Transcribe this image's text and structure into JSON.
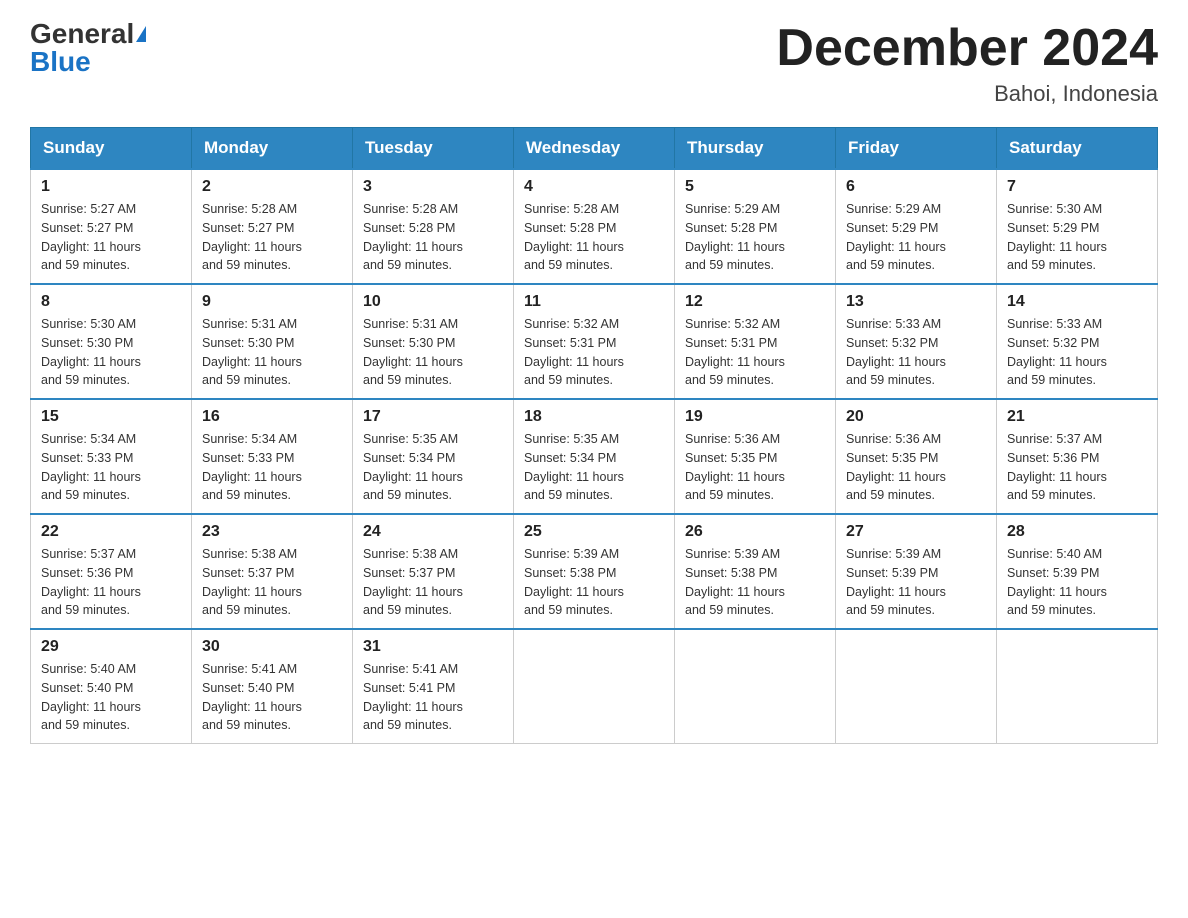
{
  "header": {
    "logo_general": "General",
    "logo_blue": "Blue",
    "month_title": "December 2024",
    "location": "Bahoi, Indonesia"
  },
  "weekdays": [
    "Sunday",
    "Monday",
    "Tuesday",
    "Wednesday",
    "Thursday",
    "Friday",
    "Saturday"
  ],
  "weeks": [
    [
      {
        "day": "1",
        "sunrise": "5:27 AM",
        "sunset": "5:27 PM",
        "daylight": "11 hours and 59 minutes."
      },
      {
        "day": "2",
        "sunrise": "5:28 AM",
        "sunset": "5:27 PM",
        "daylight": "11 hours and 59 minutes."
      },
      {
        "day": "3",
        "sunrise": "5:28 AM",
        "sunset": "5:28 PM",
        "daylight": "11 hours and 59 minutes."
      },
      {
        "day": "4",
        "sunrise": "5:28 AM",
        "sunset": "5:28 PM",
        "daylight": "11 hours and 59 minutes."
      },
      {
        "day": "5",
        "sunrise": "5:29 AM",
        "sunset": "5:28 PM",
        "daylight": "11 hours and 59 minutes."
      },
      {
        "day": "6",
        "sunrise": "5:29 AM",
        "sunset": "5:29 PM",
        "daylight": "11 hours and 59 minutes."
      },
      {
        "day": "7",
        "sunrise": "5:30 AM",
        "sunset": "5:29 PM",
        "daylight": "11 hours and 59 minutes."
      }
    ],
    [
      {
        "day": "8",
        "sunrise": "5:30 AM",
        "sunset": "5:30 PM",
        "daylight": "11 hours and 59 minutes."
      },
      {
        "day": "9",
        "sunrise": "5:31 AM",
        "sunset": "5:30 PM",
        "daylight": "11 hours and 59 minutes."
      },
      {
        "day": "10",
        "sunrise": "5:31 AM",
        "sunset": "5:30 PM",
        "daylight": "11 hours and 59 minutes."
      },
      {
        "day": "11",
        "sunrise": "5:32 AM",
        "sunset": "5:31 PM",
        "daylight": "11 hours and 59 minutes."
      },
      {
        "day": "12",
        "sunrise": "5:32 AM",
        "sunset": "5:31 PM",
        "daylight": "11 hours and 59 minutes."
      },
      {
        "day": "13",
        "sunrise": "5:33 AM",
        "sunset": "5:32 PM",
        "daylight": "11 hours and 59 minutes."
      },
      {
        "day": "14",
        "sunrise": "5:33 AM",
        "sunset": "5:32 PM",
        "daylight": "11 hours and 59 minutes."
      }
    ],
    [
      {
        "day": "15",
        "sunrise": "5:34 AM",
        "sunset": "5:33 PM",
        "daylight": "11 hours and 59 minutes."
      },
      {
        "day": "16",
        "sunrise": "5:34 AM",
        "sunset": "5:33 PM",
        "daylight": "11 hours and 59 minutes."
      },
      {
        "day": "17",
        "sunrise": "5:35 AM",
        "sunset": "5:34 PM",
        "daylight": "11 hours and 59 minutes."
      },
      {
        "day": "18",
        "sunrise": "5:35 AM",
        "sunset": "5:34 PM",
        "daylight": "11 hours and 59 minutes."
      },
      {
        "day": "19",
        "sunrise": "5:36 AM",
        "sunset": "5:35 PM",
        "daylight": "11 hours and 59 minutes."
      },
      {
        "day": "20",
        "sunrise": "5:36 AM",
        "sunset": "5:35 PM",
        "daylight": "11 hours and 59 minutes."
      },
      {
        "day": "21",
        "sunrise": "5:37 AM",
        "sunset": "5:36 PM",
        "daylight": "11 hours and 59 minutes."
      }
    ],
    [
      {
        "day": "22",
        "sunrise": "5:37 AM",
        "sunset": "5:36 PM",
        "daylight": "11 hours and 59 minutes."
      },
      {
        "day": "23",
        "sunrise": "5:38 AM",
        "sunset": "5:37 PM",
        "daylight": "11 hours and 59 minutes."
      },
      {
        "day": "24",
        "sunrise": "5:38 AM",
        "sunset": "5:37 PM",
        "daylight": "11 hours and 59 minutes."
      },
      {
        "day": "25",
        "sunrise": "5:39 AM",
        "sunset": "5:38 PM",
        "daylight": "11 hours and 59 minutes."
      },
      {
        "day": "26",
        "sunrise": "5:39 AM",
        "sunset": "5:38 PM",
        "daylight": "11 hours and 59 minutes."
      },
      {
        "day": "27",
        "sunrise": "5:39 AM",
        "sunset": "5:39 PM",
        "daylight": "11 hours and 59 minutes."
      },
      {
        "day": "28",
        "sunrise": "5:40 AM",
        "sunset": "5:39 PM",
        "daylight": "11 hours and 59 minutes."
      }
    ],
    [
      {
        "day": "29",
        "sunrise": "5:40 AM",
        "sunset": "5:40 PM",
        "daylight": "11 hours and 59 minutes."
      },
      {
        "day": "30",
        "sunrise": "5:41 AM",
        "sunset": "5:40 PM",
        "daylight": "11 hours and 59 minutes."
      },
      {
        "day": "31",
        "sunrise": "5:41 AM",
        "sunset": "5:41 PM",
        "daylight": "11 hours and 59 minutes."
      },
      null,
      null,
      null,
      null
    ]
  ],
  "labels": {
    "sunrise": "Sunrise:",
    "sunset": "Sunset:",
    "daylight": "Daylight:"
  }
}
